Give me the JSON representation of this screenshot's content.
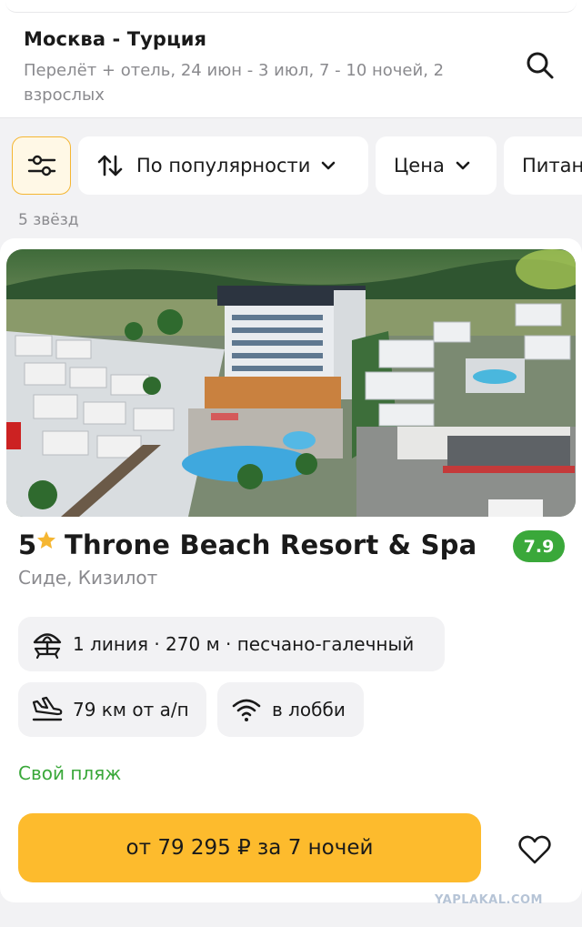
{
  "header": {
    "route": "Москва - Турция",
    "details": "Перелёт + отель, 24 июн - 3 июл, 7 - 10 ночей, 2 взрослых"
  },
  "filters": {
    "sort_label": "По популярности",
    "price_label": "Цена",
    "food_label": "Питан"
  },
  "section_label": "5 звёзд",
  "hotel": {
    "stars": "5",
    "name": "Throne Beach Resort & Spa",
    "rating": "7.9",
    "location": "Сиде, Кизилот",
    "beach_info": "1 линия · 270 м · песчано-галечный",
    "airport_distance": "79 км от а/п",
    "wifi": "в лобби",
    "own_beach": "Свой пляж",
    "price_label": "от 79 295 ₽ за 7 ночей"
  },
  "watermark": "YAPLAKAL.COM",
  "colors": {
    "accent": "#fdbb2d",
    "rating_green": "#3aa83a",
    "muted": "#8a8a8e",
    "star": "#f5b632"
  },
  "icons": [
    "search-icon",
    "filter-sliders-icon",
    "sort-arrows-icon",
    "chevron-down-icon",
    "star-icon",
    "beach-umbrella-icon",
    "plane-landing-icon",
    "wifi-icon",
    "heart-icon"
  ]
}
